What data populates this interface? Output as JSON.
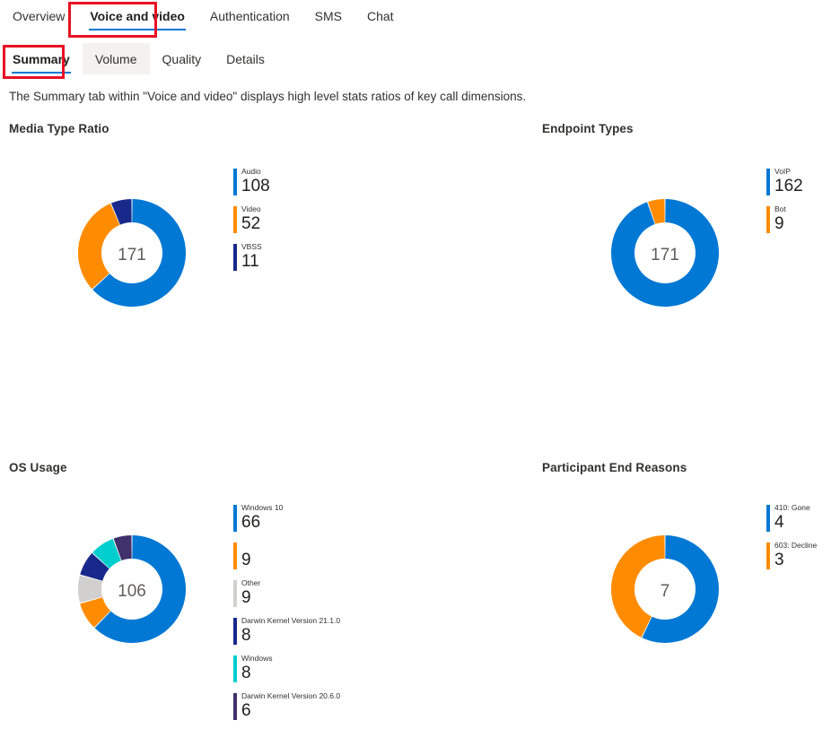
{
  "primary_tabs": [
    {
      "label": "Overview",
      "active": false,
      "hovered": false
    },
    {
      "label": "Voice and video",
      "active": true,
      "hovered": false
    },
    {
      "label": "Authentication",
      "active": false,
      "hovered": false
    },
    {
      "label": "SMS",
      "active": false,
      "hovered": false
    },
    {
      "label": "Chat",
      "active": false,
      "hovered": false
    }
  ],
  "secondary_tabs": [
    {
      "label": "Summary",
      "active": true,
      "hovered": false
    },
    {
      "label": "Volume",
      "active": false,
      "hovered": true
    },
    {
      "label": "Quality",
      "active": false,
      "hovered": false
    },
    {
      "label": "Details",
      "active": false,
      "hovered": false
    }
  ],
  "description": "The Summary tab within \"Voice and video\" displays high level stats ratios of key call dimensions.",
  "colors": {
    "blue": "#0078d4",
    "orange": "#ff8c00",
    "navy": "#17298a",
    "gray": "#d2d0ce",
    "teal": "#00cdcd",
    "purple": "#40306b",
    "accent_underline": "#0078d4",
    "annotation_red": "#e81123"
  },
  "panels": [
    {
      "title": "Media Type Ratio"
    },
    {
      "title": "Endpoint Types"
    },
    {
      "title": "OS Usage"
    },
    {
      "title": "Participant End Reasons"
    }
  ],
  "chart_data": [
    {
      "type": "pie",
      "title": "Media Type Ratio",
      "center_total": "171",
      "legend_position": "right",
      "categories": [
        "Audio",
        "Video",
        "VBSS"
      ],
      "values": [
        108,
        52,
        11
      ],
      "colors": [
        "#0078d4",
        "#ff8c00",
        "#17298a"
      ]
    },
    {
      "type": "pie",
      "title": "Endpoint Types",
      "center_total": "171",
      "legend_position": "right",
      "categories": [
        "VoIP",
        "Bot"
      ],
      "values": [
        162,
        9
      ],
      "colors": [
        "#0078d4",
        "#ff8c00"
      ]
    },
    {
      "type": "pie",
      "title": "OS Usage",
      "center_total": "106",
      "legend_position": "right",
      "categories": [
        "Windows 10",
        "",
        "Other",
        "Darwin Kernel Version 21.1.0",
        "Windows",
        "Darwin Kernel Version 20.6.0"
      ],
      "values": [
        66,
        9,
        9,
        8,
        8,
        6
      ],
      "colors": [
        "#0078d4",
        "#ff8c00",
        "#d2d0ce",
        "#17298a",
        "#00cdcd",
        "#40306b"
      ]
    },
    {
      "type": "pie",
      "title": "Participant End Reasons",
      "center_total": "7",
      "legend_position": "right",
      "categories": [
        "410: Gone",
        "603: Decline"
      ],
      "values": [
        4,
        3
      ],
      "colors": [
        "#0078d4",
        "#ff8c00"
      ]
    }
  ]
}
